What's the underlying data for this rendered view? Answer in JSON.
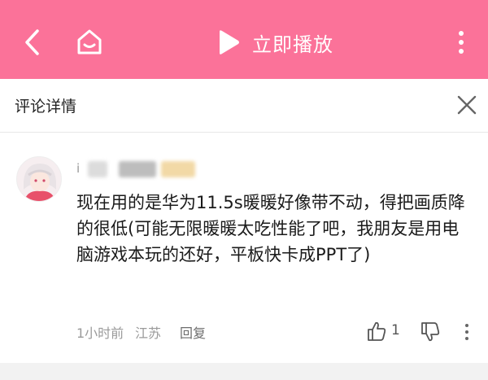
{
  "header": {
    "play_label": "立即播放",
    "accent_color": "#fb7299",
    "icons": [
      "back-icon",
      "home-icon",
      "play-icon",
      "more-vertical-icon"
    ]
  },
  "detail": {
    "title": "评论详情"
  },
  "comment": {
    "username_visible": "i",
    "text": "现在用的是华为11.5s暖暖好像带不动，得把画质降的很低(可能无限暖暖太吃性能了吧，我朋友是用电脑游戏本玩的还好，平板快卡成PPT了)",
    "time": "1小时前",
    "location": "江苏",
    "reply_label": "回复",
    "like_count": "1"
  }
}
